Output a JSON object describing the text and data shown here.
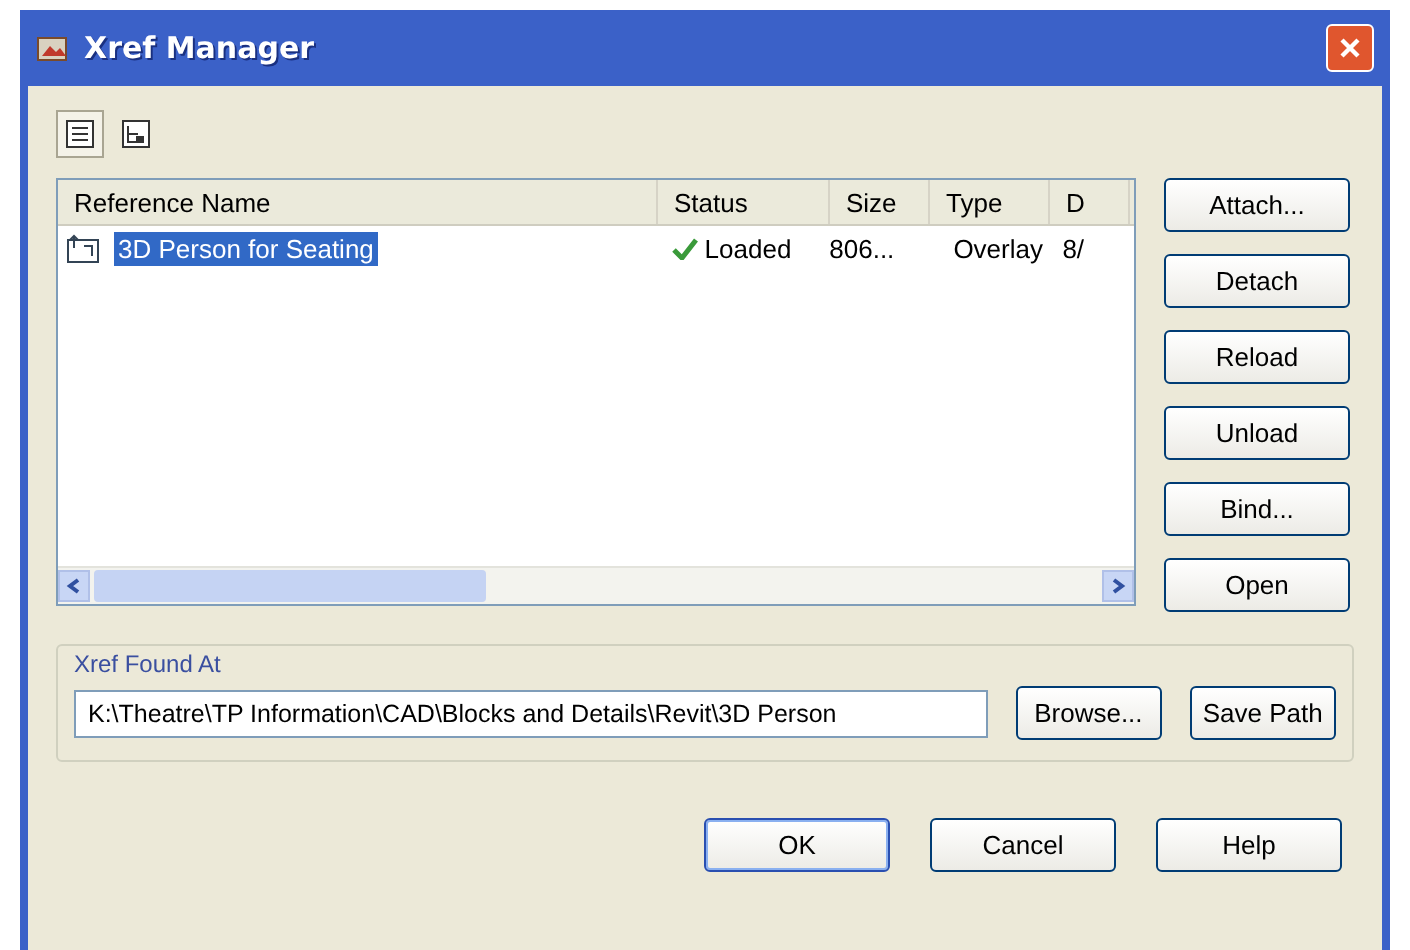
{
  "window": {
    "title": "Xref Manager"
  },
  "view_buttons": [
    {
      "kind": "list",
      "selected": true
    },
    {
      "kind": "tree",
      "selected": false
    }
  ],
  "table": {
    "columns": [
      "Reference Name",
      "Status",
      "Size",
      "Type",
      "D"
    ],
    "rows": [
      {
        "name": "3D Person for Seating",
        "status": "Loaded",
        "size": "806...",
        "type": "Overlay",
        "column_5": "8/",
        "selected": true
      }
    ]
  },
  "side_buttons": [
    "Attach...",
    "Detach",
    "Reload",
    "Unload",
    "Bind...",
    "Open"
  ],
  "found_at": {
    "label": "Xref Found At",
    "value": "K:\\Theatre\\TP Information\\CAD\\Blocks and Details\\Revit\\3D Person",
    "buttons": [
      "Browse...",
      "Save Path"
    ]
  },
  "buttons": [
    "OK",
    "Cancel",
    "Help"
  ]
}
